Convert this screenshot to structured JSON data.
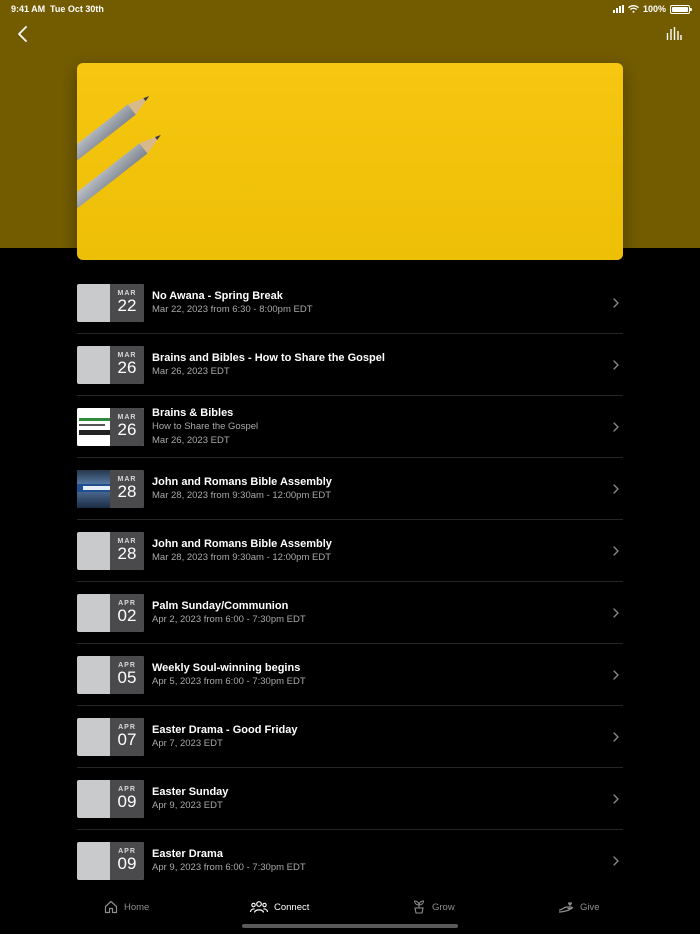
{
  "status_bar": {
    "time": "9:41 AM",
    "date": "Tue Oct 30th",
    "battery": "100%"
  },
  "colors": {
    "header_band": "#735c00",
    "hero": "#f2c40c",
    "background": "#000000"
  },
  "nav": {
    "back_icon": "chevron-left-icon",
    "stats_icon": "audio-bars-icon"
  },
  "events": [
    {
      "month": "MAR",
      "day": "22",
      "title": "No Awana - Spring Break",
      "subtitle": "Mar 22, 2023 from 6:30 - 8:00pm EDT",
      "subtitle2": "",
      "thumb": "gray"
    },
    {
      "month": "MAR",
      "day": "26",
      "title": "Brains and Bibles - How to Share the Gospel",
      "subtitle": "Mar 26, 2023 EDT",
      "subtitle2": "",
      "thumb": "gray"
    },
    {
      "month": "MAR",
      "day": "26",
      "title": "Brains & Bibles",
      "subtitle": "How to Share the Gospel",
      "subtitle2": "Mar 26, 2023 EDT",
      "thumb": "gospel"
    },
    {
      "month": "MAR",
      "day": "28",
      "title": "John and Romans Bible Assembly",
      "subtitle": "Mar 28, 2023 from 9:30am - 12:00pm EDT",
      "subtitle2": "",
      "thumb": "assembly"
    },
    {
      "month": "MAR",
      "day": "28",
      "title": "John and Romans Bible Assembly",
      "subtitle": "Mar 28, 2023 from 9:30am - 12:00pm EDT",
      "subtitle2": "",
      "thumb": "gray"
    },
    {
      "month": "APR",
      "day": "02",
      "title": "Palm Sunday/Communion",
      "subtitle": "Apr 2, 2023 from 6:00 - 7:30pm EDT",
      "subtitle2": "",
      "thumb": "gray"
    },
    {
      "month": "APR",
      "day": "05",
      "title": "Weekly Soul-winning begins",
      "subtitle": "Apr 5, 2023 from 6:00 - 7:30pm EDT",
      "subtitle2": "",
      "thumb": "gray"
    },
    {
      "month": "APR",
      "day": "07",
      "title": "Easter Drama - Good Friday",
      "subtitle": "Apr 7, 2023 EDT",
      "subtitle2": "",
      "thumb": "gray"
    },
    {
      "month": "APR",
      "day": "09",
      "title": "Easter Sunday",
      "subtitle": "Apr 9, 2023 EDT",
      "subtitle2": "",
      "thumb": "gray"
    },
    {
      "month": "APR",
      "day": "09",
      "title": "Easter Drama",
      "subtitle": "Apr 9, 2023 from 6:00 - 7:30pm EDT",
      "subtitle2": "",
      "thumb": "gray"
    }
  ],
  "tabs": [
    {
      "label": "Home",
      "icon": "home-icon",
      "active": false
    },
    {
      "label": "Connect",
      "icon": "people-icon",
      "active": true
    },
    {
      "label": "Grow",
      "icon": "sprout-icon",
      "active": false
    },
    {
      "label": "Give",
      "icon": "hand-heart-icon",
      "active": false
    }
  ]
}
